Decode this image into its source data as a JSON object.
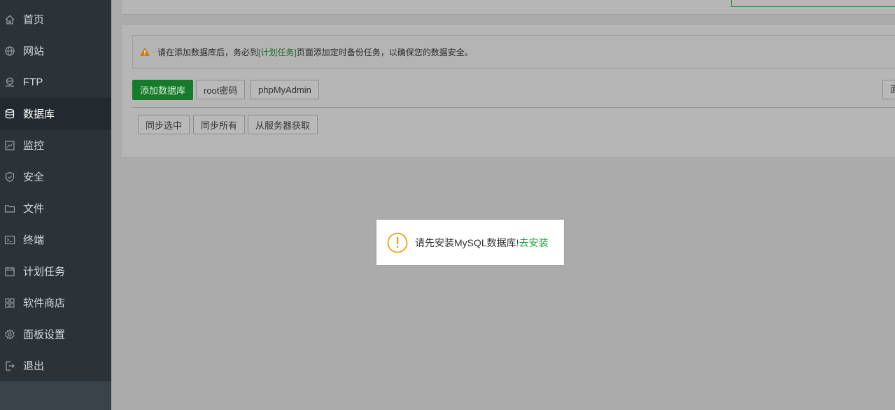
{
  "sidebar": {
    "items": [
      {
        "label": "首页",
        "icon": "home-icon"
      },
      {
        "label": "网站",
        "icon": "globe-icon"
      },
      {
        "label": "FTP",
        "icon": "ftp-icon"
      },
      {
        "label": "数据库",
        "icon": "database-icon",
        "active": true
      },
      {
        "label": "监控",
        "icon": "monitor-icon"
      },
      {
        "label": "安全",
        "icon": "shield-icon"
      },
      {
        "label": "文件",
        "icon": "folder-icon"
      },
      {
        "label": "终端",
        "icon": "terminal-icon"
      },
      {
        "label": "计划任务",
        "icon": "calendar-icon"
      },
      {
        "label": "软件商店",
        "icon": "apps-icon"
      },
      {
        "label": "面板设置",
        "icon": "gear-icon"
      },
      {
        "label": "退出",
        "icon": "logout-icon"
      }
    ]
  },
  "alert": {
    "prefix": "请在添加数据库后，务必到",
    "link": "[计划任务]",
    "suffix": "页面添加定时备份任务，以确保您的数据安全。"
  },
  "toolbar": {
    "add_db": "添加数据库",
    "root_pwd": "root密码",
    "phpmyadmin": "phpMyAdmin",
    "edge_label": "面"
  },
  "sync": {
    "sync_selected": "同步选中",
    "sync_all": "同步所有",
    "fetch_from_server": "从服务器获取"
  },
  "modal": {
    "message": "请先安装MySQL数据库!",
    "action": "去安装"
  },
  "colors": {
    "accent": "#20a53a",
    "warning": "#e8a21c",
    "sidebar_bg": "#2b3238"
  }
}
